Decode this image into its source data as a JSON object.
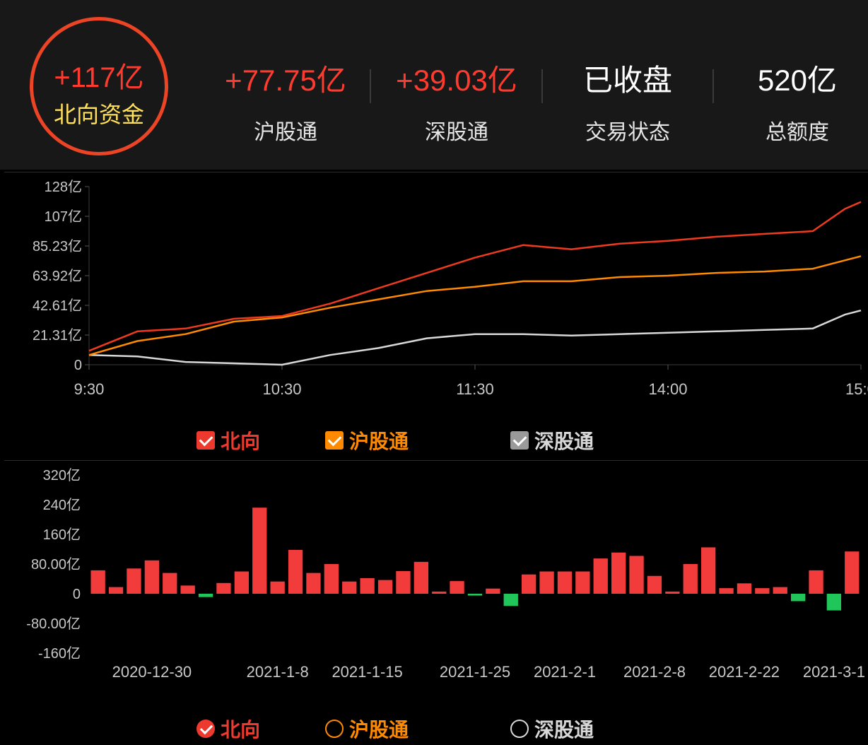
{
  "summary": {
    "total_value": "+117亿",
    "total_label": "北向资金",
    "stats": [
      {
        "value": "+77.75亿",
        "label": "沪股通"
      },
      {
        "value": "+39.03亿",
        "label": "深股通"
      },
      {
        "value": "已收盘",
        "label": "交易状态"
      },
      {
        "value": "520亿",
        "label": "总额度"
      }
    ]
  },
  "colors": {
    "north": "#ee3a1e",
    "shanghai": "#ff8a00",
    "shenzhen": "#d8d8d8",
    "up": "#f23b3b",
    "down": "#21c65a"
  },
  "intraday_legend": [
    {
      "label": "北向",
      "checked": true
    },
    {
      "label": "沪股通",
      "checked": true
    },
    {
      "label": "深股通",
      "checked": true
    }
  ],
  "daily_legend": [
    {
      "label": "北向",
      "selected": true
    },
    {
      "label": "沪股通",
      "selected": false
    },
    {
      "label": "深股通",
      "selected": false
    }
  ],
  "chart_data": [
    {
      "type": "line",
      "y_tick_labels": [
        "128亿",
        "107亿",
        "85.23亿",
        "63.92亿",
        "42.61亿",
        "21.31亿",
        "0"
      ],
      "x_tick_labels": [
        "9:30",
        "10:30",
        "11:30",
        "14:00",
        "15:00"
      ],
      "ylim": [
        0,
        128
      ],
      "unit": "亿",
      "x": [
        "9:30",
        "9:45",
        "10:00",
        "10:15",
        "10:30",
        "10:45",
        "11:00",
        "11:15",
        "11:30",
        "13:15",
        "13:30",
        "13:45",
        "14:00",
        "14:15",
        "14:30",
        "14:45",
        "14:55",
        "15:00"
      ],
      "series": [
        {
          "name": "北向",
          "values": [
            10,
            24,
            26,
            33,
            35,
            44,
            55,
            66,
            77,
            86,
            83,
            87,
            89,
            92,
            94,
            96,
            112,
            117
          ]
        },
        {
          "name": "沪股通",
          "values": [
            7,
            17,
            22,
            31,
            34,
            41,
            47,
            53,
            56,
            60,
            60,
            63,
            64,
            66,
            67,
            69,
            75,
            78
          ]
        },
        {
          "name": "深股通",
          "values": [
            7,
            6,
            2,
            1,
            0,
            7,
            12,
            19,
            22,
            22,
            21,
            22,
            23,
            24,
            25,
            26,
            36,
            39
          ]
        }
      ]
    },
    {
      "type": "bar",
      "y_tick_labels": [
        "320亿",
        "240亿",
        "160亿",
        "80.00亿",
        "0",
        "-80.00亿",
        "-160亿"
      ],
      "x_tick_labels": [
        "2020-12-30",
        "2021-1-8",
        "2021-1-15",
        "2021-1-25",
        "2021-2-1",
        "2021-2-8",
        "2021-2-22",
        "2021-3-1"
      ],
      "ylim": [
        -160,
        320
      ],
      "unit": "亿",
      "series": [
        {
          "name": "北向",
          "values": [
            63,
            18,
            68,
            90,
            56,
            22,
            -9,
            29,
            60,
            232,
            33,
            118,
            56,
            80,
            33,
            42,
            37,
            61,
            86,
            6,
            34,
            -5,
            14,
            -33,
            52,
            60,
            60,
            60,
            95,
            111,
            102,
            48,
            6,
            80,
            125,
            15,
            28,
            15,
            18,
            -20,
            63,
            -45,
            114
          ]
        }
      ]
    }
  ]
}
